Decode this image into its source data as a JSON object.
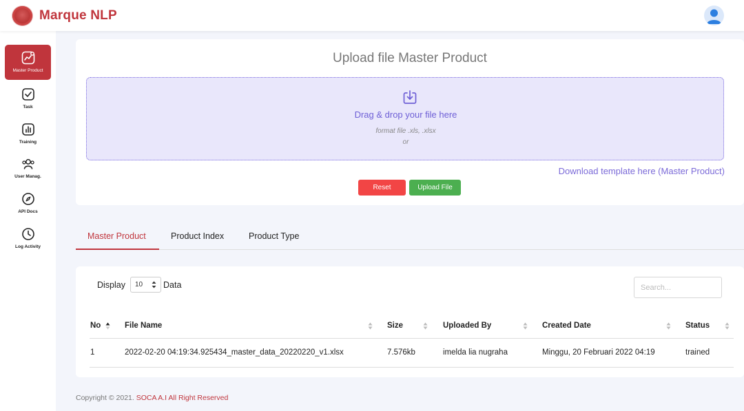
{
  "brand": {
    "name": "Marque NLP"
  },
  "sidebar": {
    "items": [
      {
        "label": "Master Product",
        "icon": "chart-icon",
        "active": true
      },
      {
        "label": "Task",
        "icon": "checkbox-icon"
      },
      {
        "label": "Training",
        "icon": "bar-chart-icon"
      },
      {
        "label": "User Manag.",
        "icon": "users-icon"
      },
      {
        "label": "API Docs",
        "icon": "compass-icon"
      },
      {
        "label": "Log Activity",
        "icon": "clock-icon"
      }
    ]
  },
  "upload": {
    "title": "Upload file Master Product",
    "drop_text": "Drag & drop your file here",
    "format_text": "format file .xls, .xlsx",
    "or_text": "or",
    "template_link": "Download template here (Master Product)",
    "reset_label": "Reset",
    "upload_label": "Upload File"
  },
  "tabs": [
    {
      "label": "Master Product",
      "active": true
    },
    {
      "label": "Product Index"
    },
    {
      "label": "Product Type"
    }
  ],
  "table": {
    "display_label": "Display",
    "page_size": "10",
    "data_label": "Data",
    "search_placeholder": "Search...",
    "columns": [
      "No",
      "File Name",
      "Size",
      "Uploaded By",
      "Created Date",
      "Status"
    ],
    "rows": [
      {
        "no": "1",
        "file_name": "2022-02-20 04:19:34.925434_master_data_20220220_v1.xlsx",
        "size": "7.576kb",
        "uploaded_by": "imelda lia nugraha",
        "created_date": "Minggu, 20 Februari 2022 04:19",
        "status": "trained"
      }
    ]
  },
  "footer": {
    "copyright": "Copyright © 2021.",
    "company": "SOCA A.I All Right Reserved"
  },
  "colors": {
    "brand": "#c0353c",
    "accent_purple": "#7b6ad8",
    "reset": "#f24545",
    "upload": "#4caf50"
  }
}
